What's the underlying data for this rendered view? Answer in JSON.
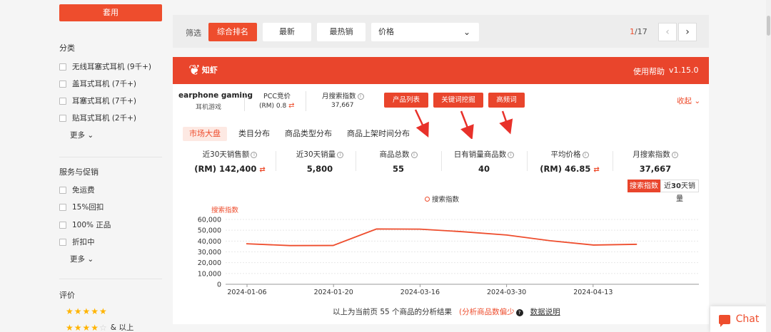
{
  "sidebar": {
    "apply_label": "套用",
    "category_title": "分类",
    "categories": [
      {
        "label": "无线耳塞式耳机 (9千+)"
      },
      {
        "label": "盖耳式耳机 (7千+)"
      },
      {
        "label": "耳塞式耳机 (7千+)"
      },
      {
        "label": "贴耳式耳机 (2千+)"
      }
    ],
    "more_label": "更多",
    "service_title": "服务与促销",
    "services": [
      {
        "label": "免运费"
      },
      {
        "label": "15%回扣"
      },
      {
        "label": "100% 正品"
      },
      {
        "label": "折扣中"
      }
    ],
    "rating_title": "评价",
    "rating_rows": [
      {
        "stars": 5,
        "suffix": ""
      },
      {
        "stars": 4,
        "suffix": "& 以上"
      }
    ]
  },
  "filter": {
    "label": "筛选",
    "buttons": [
      "综合排名",
      "最新",
      "最热销"
    ],
    "active_index": 0,
    "price_label": "价格",
    "page_current": "1",
    "page_total": "/17",
    "prev_icon": "‹",
    "next_icon": "›"
  },
  "plugin": {
    "logo_text": "知虾",
    "help_label": "使用帮助",
    "version": "v1.15.0",
    "accent_color": "#e9452c",
    "keyword": "earphone gaming",
    "keyword_translation": "耳机游戏",
    "pcc_label": "PCC竞价",
    "pcc_value": "(RM) 0.8",
    "search_index_label": "月搜索指数",
    "search_index_value": "37,667",
    "action_buttons": [
      "产品列表",
      "关键词挖掘",
      "高频词"
    ],
    "collapse_label": "收起",
    "tabs": [
      "市场大盘",
      "类目分布",
      "商品类型分布",
      "商品上架时间分布"
    ],
    "active_tab": 0,
    "stats": [
      {
        "label": "近30天销售额",
        "value": "(RM) 142,400",
        "swap": true
      },
      {
        "label": "近30天销量",
        "value": "5,800",
        "swap": false
      },
      {
        "label": "商品总数",
        "value": "55",
        "swap": false
      },
      {
        "label": "日有销量商品数",
        "value": "40",
        "swap": false
      },
      {
        "label": "平均价格",
        "value": "(RM) 46.85",
        "swap": true
      },
      {
        "label": "月搜索指数",
        "value": "37,667",
        "swap": false
      }
    ],
    "toggle_on": "搜索指数",
    "toggle_off_prefix": "近",
    "toggle_off_bold": "30",
    "toggle_off_suffix": "天销量",
    "footer_text": "以上为当前页 55 个商品的分析结果",
    "footer_warn": "(分析商品数偏少",
    "footer_link": "数据说明",
    "chat_label": "Chat"
  },
  "chart_data": {
    "type": "line",
    "title": "",
    "legend": [
      "搜索指数"
    ],
    "ylabel": "搜索指数",
    "ylim": [
      0,
      60000
    ],
    "yticks": [
      "60,000",
      "50,000",
      "40,000",
      "30,000",
      "20,000",
      "10,000",
      "0"
    ],
    "xtick_labels": [
      "2024-01-06",
      "2024-01-20",
      "2024-03-16",
      "2024-03-30",
      "2024-04-13"
    ],
    "series": [
      {
        "name": "搜索指数",
        "color": "#ee4d2d",
        "values": [
          37500,
          35800,
          35900,
          51200,
          51000,
          48600,
          45600,
          40300,
          36300,
          37000
        ]
      }
    ]
  }
}
